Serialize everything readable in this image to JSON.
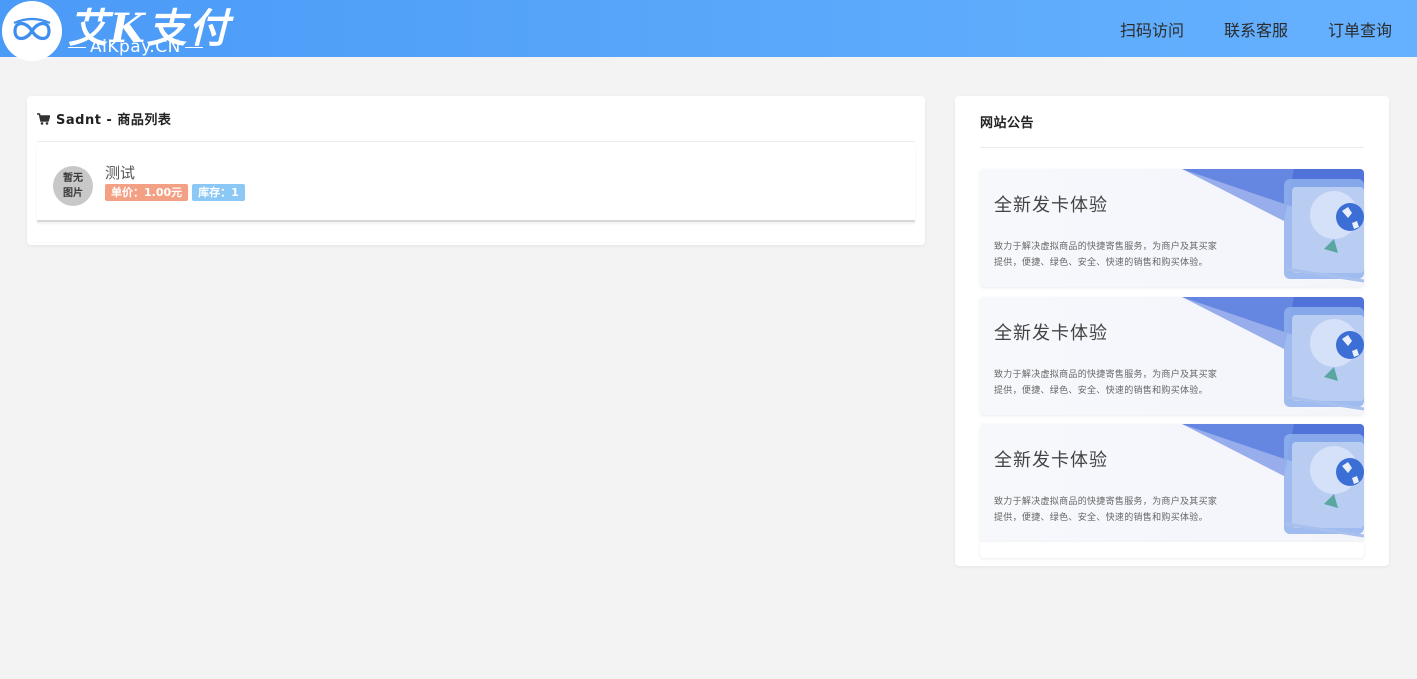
{
  "header": {
    "logo_title": "艾K支付",
    "logo_subtitle": "AiKpay.CN",
    "nav": [
      {
        "label": "扫码访问"
      },
      {
        "label": "联系客服"
      },
      {
        "label": "订单查询"
      }
    ],
    "colors": {
      "bar_start": "#4a9af7",
      "bar_end": "#66b1ff"
    }
  },
  "product_list": {
    "title": "Sadnt - 商品列表",
    "icon": "cart-icon",
    "items": [
      {
        "thumb_line1": "暂无",
        "thumb_line2": "图片",
        "name": "测试",
        "price_tag": "单价：1.00元",
        "stock_tag": "库存：1"
      }
    ]
  },
  "announcement": {
    "title": "网站公告",
    "banners": [
      {
        "title": "全新发卡体验",
        "desc_line1": "致力于解决虚拟商品的快捷寄售服务，为商户及其买家",
        "desc_line2": "提供，便捷、绿色、安全、快速的销售和购买体验。"
      },
      {
        "title": "全新发卡体验",
        "desc_line1": "致力于解决虚拟商品的快捷寄售服务，为商户及其买家",
        "desc_line2": "提供，便捷、绿色、安全、快速的销售和购买体验。"
      },
      {
        "title": "全新发卡体验",
        "desc_line1": "致力于解决虚拟商品的快捷寄售服务，为商户及其买家",
        "desc_line2": "提供，便捷、绿色、安全、快速的销售和购买体验。"
      }
    ]
  }
}
